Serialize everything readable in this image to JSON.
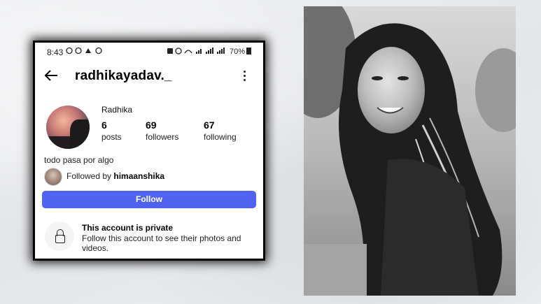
{
  "status_bar": {
    "time": "8:43",
    "left_icons": "© © © ©",
    "right_icons": "▣ ⏰ ≡ ≡ ≡ ≡",
    "battery": "70%"
  },
  "profile": {
    "username": "radhikayadav._",
    "display_name": "Radhika",
    "posts_count": "6",
    "posts_label": "posts",
    "followers_count": "69",
    "followers_label": "followers",
    "following_count": "67",
    "following_label": "following",
    "bio": "todo pasa por algo",
    "followed_by_prefix": "Followed by ",
    "followed_by_user": "himaanshika",
    "follow_button_label": "Follow",
    "private_title": "This account is private",
    "private_description": "Follow this account to see their photos and videos."
  },
  "colors": {
    "follow_button": "#4f63f0",
    "background": "#eceef0"
  },
  "icons": {
    "back": "back-arrow-icon",
    "more": "more-vertical-icon",
    "lock": "lock-icon"
  }
}
